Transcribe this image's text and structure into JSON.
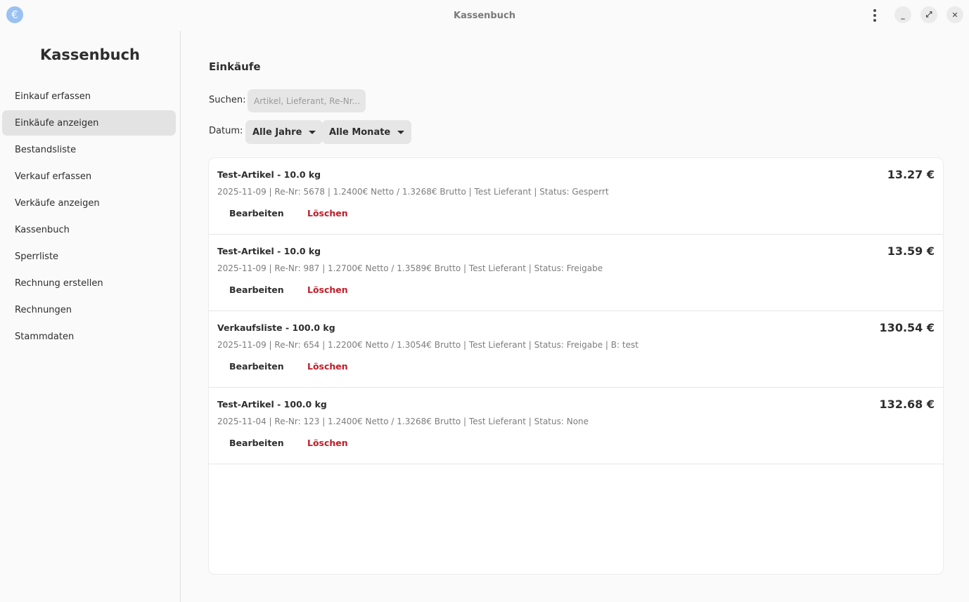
{
  "window": {
    "title": "Kassenbuch",
    "app_icon": "€",
    "minimize": "_",
    "maximize": "⤢",
    "close": "✕"
  },
  "sidebar": {
    "title": "Kassenbuch",
    "items": [
      {
        "label": "Einkauf erfassen"
      },
      {
        "label": "Einkäufe anzeigen",
        "active": true
      },
      {
        "label": "Bestandsliste"
      },
      {
        "label": "Verkauf erfassen"
      },
      {
        "label": "Verkäufe anzeigen"
      },
      {
        "label": "Kassenbuch"
      },
      {
        "label": "Sperrliste"
      },
      {
        "label": "Rechnung erstellen"
      },
      {
        "label": "Rechnungen"
      },
      {
        "label": "Stammdaten"
      }
    ]
  },
  "main": {
    "title": "Einkäufe",
    "search_label": "Suchen:",
    "search_placeholder": "Artikel, Lieferant, Re-Nr...",
    "search_value": "",
    "date_label": "Datum:",
    "year_select": "Alle Jahre",
    "month_select": "Alle Monate",
    "edit_label": "Bearbeiten",
    "delete_label": "Löschen",
    "purchases": [
      {
        "title": "Test-Artikel - 10.0 kg",
        "amount": "13.27 €",
        "detail": "2025-11-09 | Re-Nr: 5678 | 1.2400€ Netto / 1.3268€ Brutto | Test Lieferant | Status: Gesperrt"
      },
      {
        "title": "Test-Artikel - 10.0 kg",
        "amount": "13.59 €",
        "detail": "2025-11-09 | Re-Nr: 987 | 1.2700€ Netto / 1.3589€ Brutto | Test Lieferant | Status: Freigabe"
      },
      {
        "title": "Verkaufsliste - 100.0 kg",
        "amount": "130.54 €",
        "detail": "2025-11-09 | Re-Nr: 654 | 1.2200€ Netto / 1.3054€ Brutto | Test Lieferant | Status: Freigabe | B: test"
      },
      {
        "title": "Test-Artikel - 100.0 kg",
        "amount": "132.68 €",
        "detail": "2025-11-04 | Re-Nr: 123 | 1.2400€ Netto / 1.3268€ Brutto | Test Lieferant | Status: None"
      }
    ]
  }
}
